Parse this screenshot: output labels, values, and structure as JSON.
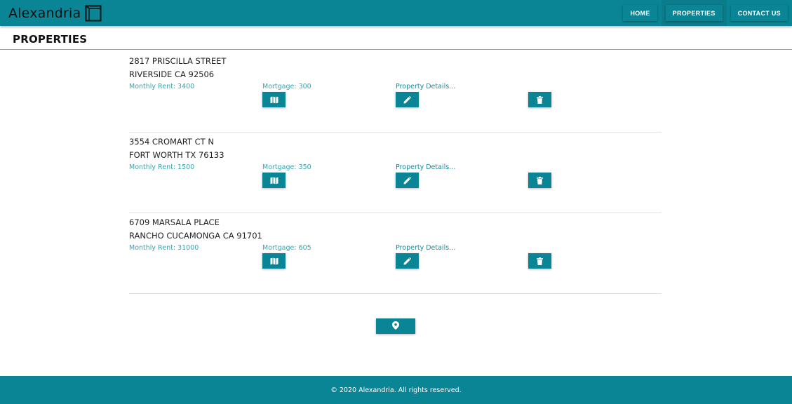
{
  "header": {
    "brand": "Alexandria",
    "nav": [
      {
        "label": "HOME"
      },
      {
        "label": "PROPERTIES"
      },
      {
        "label": "CONTACT US"
      }
    ]
  },
  "page": {
    "title": "PROPERTIES"
  },
  "properties": [
    {
      "street": "2817 PRISCILLA STREET",
      "city": "RIVERSIDE CA 92506",
      "rent": "Monthly Rent: 3400",
      "mortgage": "Mortgage: 300",
      "details": "Property Details..."
    },
    {
      "street": "3554 CROMART CT N",
      "city": "FORT WORTH TX 76133",
      "rent": "Monthly Rent: 1500",
      "mortgage": "Mortgage: 350",
      "details": "Property Details..."
    },
    {
      "street": "6709 MARSALA PLACE",
      "city": "RANCHO CUCAMONGA CA 91701",
      "rent": "Monthly Rent: 31000",
      "mortgage": "Mortgage: 605",
      "details": "Property Details..."
    }
  ],
  "icons": {
    "map": "map-icon",
    "edit": "pencil-icon",
    "delete": "trash-icon",
    "add": "location-pin-icon"
  },
  "colors": {
    "primary": "#0a8595",
    "accent_text": "#3aa3ad"
  },
  "footer": {
    "text": "© 2020 Alexandria. All rights reserved."
  }
}
